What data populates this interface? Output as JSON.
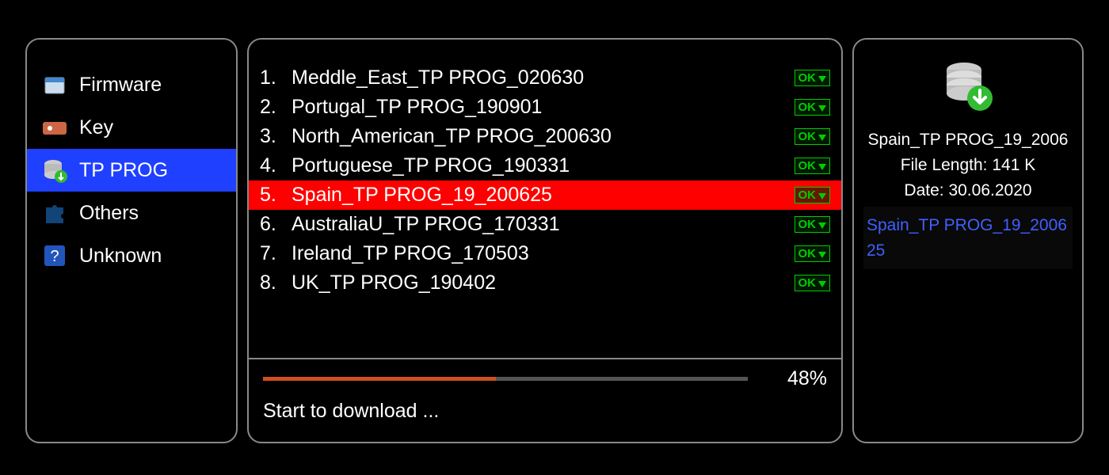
{
  "sidebar": {
    "items": [
      {
        "label": "Firmware",
        "icon": "firmware"
      },
      {
        "label": "Key",
        "icon": "key"
      },
      {
        "label": "TP PROG",
        "icon": "db-download",
        "selected": true
      },
      {
        "label": "Others",
        "icon": "puzzle"
      },
      {
        "label": "Unknown",
        "icon": "question"
      }
    ]
  },
  "list": {
    "items": [
      {
        "num": "1.",
        "label": "Meddle_East_TP PROG_020630",
        "status": "OK"
      },
      {
        "num": "2.",
        "label": "Portugal_TP PROG_190901",
        "status": "OK"
      },
      {
        "num": "3.",
        "label": "North_American_TP PROG_200630",
        "status": "OK"
      },
      {
        "num": "4.",
        "label": "Portuguese_TP PROG_190331",
        "status": "OK"
      },
      {
        "num": "5.",
        "label": "Spain_TP PROG_19_200625",
        "status": "OK",
        "selected": true
      },
      {
        "num": "6.",
        "label": "AustraliaU_TP PROG_170331",
        "status": "OK"
      },
      {
        "num": "7.",
        "label": "Ireland_TP PROG_170503",
        "status": "OK"
      },
      {
        "num": "8.",
        "label": "UK_TP PROG_190402",
        "status": "OK"
      }
    ]
  },
  "progress": {
    "percent": 48,
    "percent_label": "48%",
    "status": "Start to download ..."
  },
  "info": {
    "title": "Spain_TP PROG_19_2006",
    "length_label": "File Length: 141 K",
    "date_label": "Date: 30.06.2020",
    "queue": "Spain_TP PROG_19_200625"
  }
}
